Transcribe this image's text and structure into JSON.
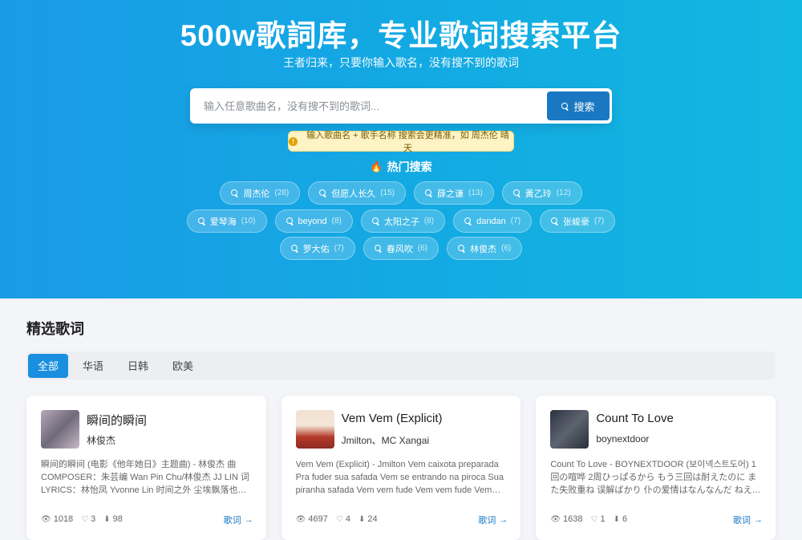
{
  "hero": {
    "title": "500w歌詞库，专业歌词搜索平台",
    "subtitle": "王者归来，只要你输入歌名，没有搜不到的歌词"
  },
  "search": {
    "placeholder": "输入任意歌曲名，没有搜不到的歌词...",
    "button_label": "搜索"
  },
  "tip": {
    "text": "输入歌曲名 + 歌手名称 搜索会更精准，如 周杰伦 晴天"
  },
  "hot": {
    "title": "热门搜索",
    "rows": [
      [
        {
          "label": "周杰伦",
          "count": "(28)"
        },
        {
          "label": "但愿人长久",
          "count": "(15)"
        },
        {
          "label": "薛之谦",
          "count": "(13)"
        },
        {
          "label": "黃乙玲",
          "count": "(12)"
        }
      ],
      [
        {
          "label": "爱琴海",
          "count": "(10)"
        },
        {
          "label": "beyond",
          "count": "(8)"
        },
        {
          "label": "太阳之子",
          "count": "(8)"
        },
        {
          "label": "dandan",
          "count": "(7)"
        },
        {
          "label": "张峻豪",
          "count": "(7)"
        }
      ],
      [
        {
          "label": "罗大佑",
          "count": "(7)"
        },
        {
          "label": "春风吹",
          "count": "(6)"
        },
        {
          "label": "林俊杰",
          "count": "(6)"
        }
      ]
    ]
  },
  "section": {
    "title": "精选歌词",
    "tabs": [
      {
        "label": "全部",
        "active": true
      },
      {
        "label": "华语",
        "active": false
      },
      {
        "label": "日韩",
        "active": false
      },
      {
        "label": "欧美",
        "active": false
      }
    ]
  },
  "cards": [
    {
      "song": "瞬间的瞬间",
      "artist": "林俊杰",
      "excerpt": "瞬间的瞬间 (电影《他年她日》主题曲) - 林俊杰 曲COMPOSER：朱芸编 Wan Pin Chu/林俊杰 JJ LIN 词LYRICS：林怡凤 Yvonne Lin 时间之外 尘埃飘落也纠…",
      "views": "1018",
      "likes": "3",
      "downloads": "98",
      "link": "歌词"
    },
    {
      "song": "Vem Vem (Explicit)",
      "artist": "Jmilton、MC Xangai",
      "excerpt": "Vem Vem (Explicit) - Jmilton Vem caixota preparada Pra fuder sua safada Vem se entrando na piroca Sua piranha safada Vem vem fude Vem vem fude Vem…",
      "views": "4697",
      "likes": "4",
      "downloads": "24",
      "link": "歌词"
    },
    {
      "song": "Count To Love",
      "artist": "boynextdoor",
      "excerpt": "Count To Love - BOYNEXTDOOR (보이넥스트도어) 1回の喧哗 2周ひっぱるから もう三回は耐えたのに また失败重ね 误解ばかり 仆の爱情はなんなんだ ねえどうし…",
      "views": "1638",
      "likes": "1",
      "downloads": "6",
      "link": "歌词"
    }
  ],
  "colors": {
    "hero_start": "#1a9be6",
    "hero_end": "#12b7e1",
    "accent": "#1a78c2",
    "tab_active": "#1a8fe0"
  }
}
